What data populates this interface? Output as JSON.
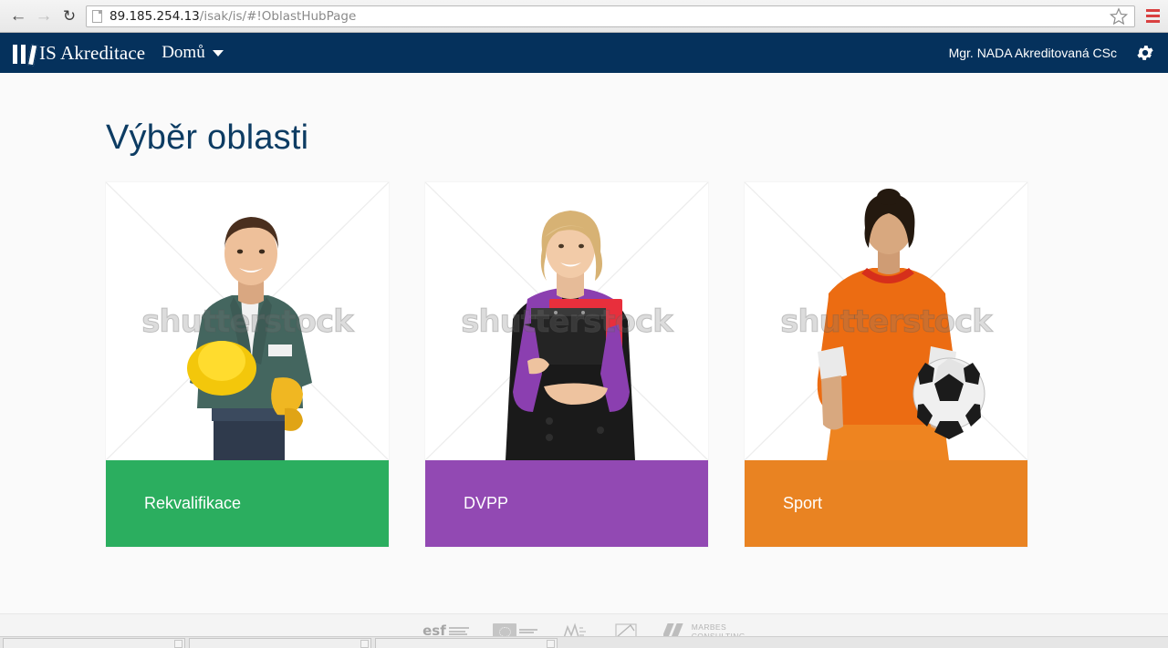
{
  "browser": {
    "back_label": "←",
    "forward_label": "→",
    "reload_label": "↻",
    "url_main": "89.185.254.13",
    "url_path": "/isak/is/#!OblastHubPage",
    "url_full": "89.185.254.13/isak/is/#!OblastHubPage",
    "bookmark_icon": "star-icon",
    "menu_icon": "hamburger-menu-icon"
  },
  "navbar": {
    "logo_icon": "books-icon",
    "brand": "IS Akreditace",
    "home_label": "Domů",
    "home_caret_icon": "chevron-down-icon",
    "user": "Mgr. NADA Akreditovaná CSc",
    "settings_icon": "gear-icon",
    "background_color": "#05315c"
  },
  "page": {
    "title": "Výběr oblasti",
    "title_color": "#0d3c63",
    "background_color": "#fafafa"
  },
  "cards": [
    {
      "label": "Rekvalifikace",
      "color": "#2bae5f",
      "photo_alt": "smiling-workman-with-hardhat",
      "watermark": "shutterstock"
    },
    {
      "label": "DVPP",
      "color": "#9249b3",
      "photo_alt": "smiling-businesswoman-with-clipboard",
      "watermark": "shutterstock"
    },
    {
      "label": "Sport",
      "color": "#e98322",
      "photo_alt": "footballer-back-view-holding-ball",
      "watermark": "shutterstock"
    }
  ],
  "footer": {
    "logos": [
      {
        "name": "esf-logo",
        "text": "esf"
      },
      {
        "name": "eu-flag-logo",
        "text": ""
      },
      {
        "name": "msmt-logo",
        "text": ""
      },
      {
        "name": "nuv-logo",
        "text": ""
      }
    ],
    "marbes": {
      "line1": "MARBES",
      "line2": "CONSULTING",
      "mark_icon": "marbes-bars-icon"
    }
  },
  "taskbar": {
    "items": [
      {
        "title": "",
        "close_icon": "close-icon"
      },
      {
        "title": "",
        "close_icon": "close-icon"
      },
      {
        "title": "",
        "close_icon": "close-icon"
      }
    ]
  }
}
